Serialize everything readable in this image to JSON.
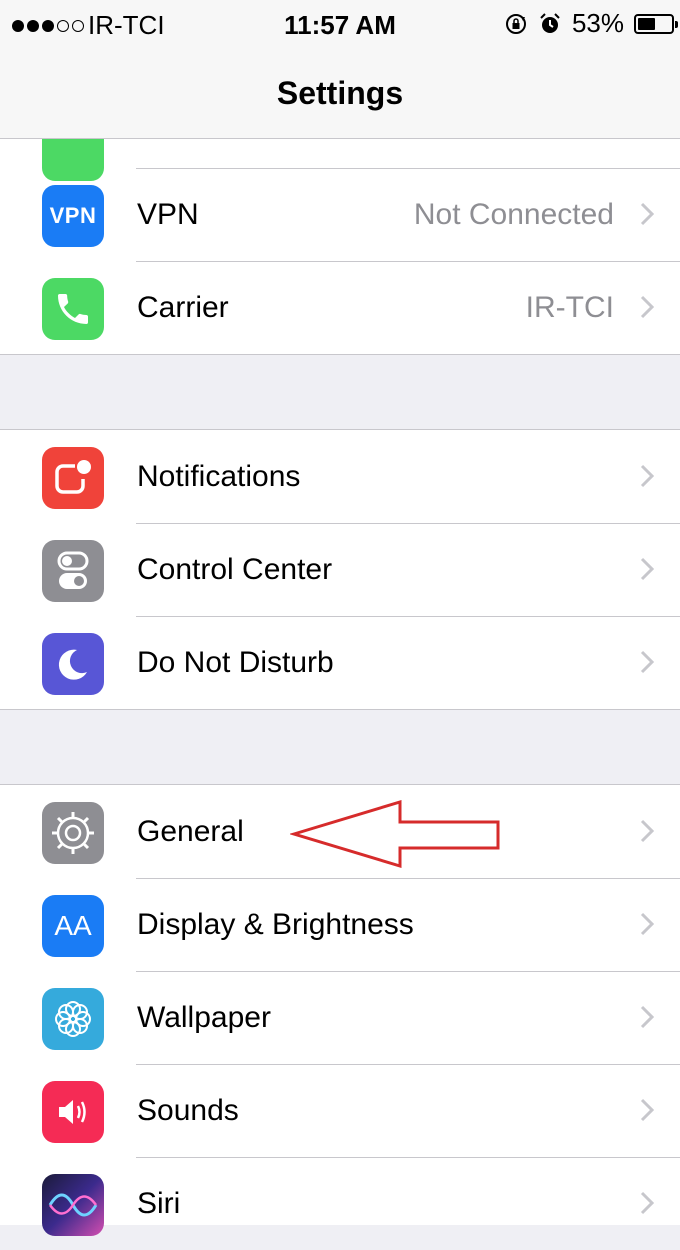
{
  "status_bar": {
    "carrier": "IR-TCI",
    "signal_bars_filled": 3,
    "signal_bars_total": 5,
    "time": "11:57 AM",
    "battery_percent_label": "53%",
    "battery_level": 0.53
  },
  "nav": {
    "title": "Settings"
  },
  "rows": {
    "vpn": {
      "icon_text": "VPN",
      "label": "VPN",
      "value": "Not Connected"
    },
    "carrier": {
      "label": "Carrier",
      "value": "IR-TCI"
    },
    "notifications": {
      "label": "Notifications"
    },
    "control_center": {
      "label": "Control Center"
    },
    "do_not_disturb": {
      "label": "Do Not Disturb"
    },
    "general": {
      "label": "General"
    },
    "display": {
      "icon_text": "AA",
      "label": "Display & Brightness"
    },
    "wallpaper": {
      "label": "Wallpaper"
    },
    "sounds": {
      "label": "Sounds"
    },
    "siri": {
      "label": "Siri"
    }
  },
  "colors": {
    "cellular_icon": "#4cd964",
    "vpn_icon": "#1a7cf5",
    "carrier_icon": "#4cd964",
    "notifications_icon": "#f0433a",
    "control_center_icon": "#8e8e93",
    "do_not_disturb_icon": "#5856d6",
    "general_icon": "#8e8e93",
    "display_icon": "#1a7cf5",
    "wallpaper_icon": "#35aadc",
    "sounds_icon": "#f52b55",
    "annotation_arrow": "#d62b2b"
  }
}
